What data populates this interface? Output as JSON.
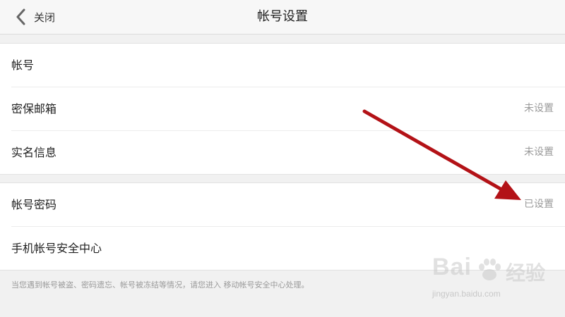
{
  "header": {
    "back_label": "关闭",
    "title": "帐号设置"
  },
  "group1": [
    {
      "label": "帐号",
      "value": ""
    },
    {
      "label": "密保邮箱",
      "value": "未设置"
    },
    {
      "label": "实名信息",
      "value": "未设置"
    }
  ],
  "group2": [
    {
      "label": "帐号密码",
      "value": "已设置"
    },
    {
      "label": "手机帐号安全中心",
      "value": ""
    }
  ],
  "footnote": "当您遇到帐号被盗、密码遗忘、帐号被冻结等情况，请您进入 移动帐号安全中心处理。",
  "watermark": {
    "brand_left": "Bai",
    "brand_right": "经验",
    "url": "jingyan.baidu.com"
  },
  "icons": {
    "back": "chevron-left-icon",
    "annotation": "red-arrow-annotation",
    "paw": "baidu-paw-icon"
  },
  "colors": {
    "annotation_arrow": "#b31217"
  }
}
